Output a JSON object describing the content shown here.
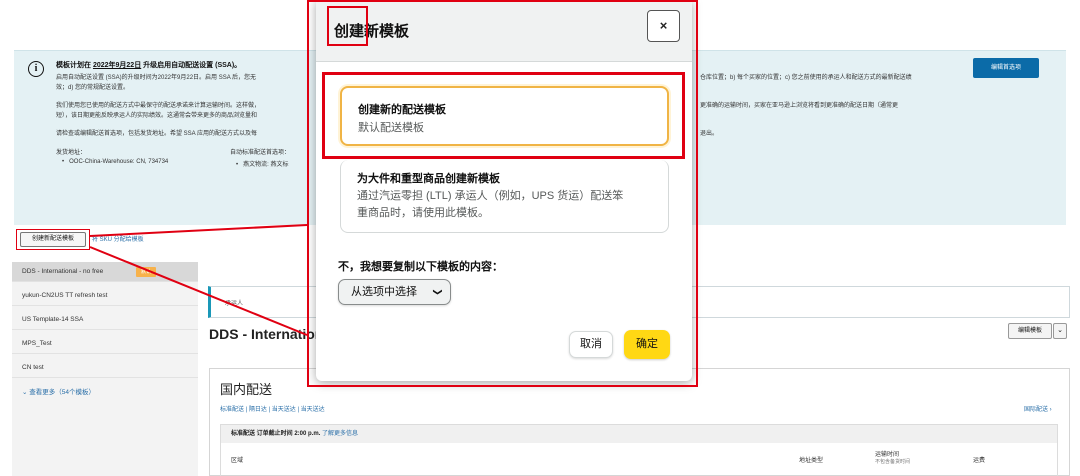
{
  "banner": {
    "title_prefix": "模板计划在",
    "title_date": "2022年9月22日",
    "title_suffix": "升级启用自动配送设置 (SSA)。",
    "line1": "启用自动配送设置 (SSA)的升级时间为2022年9月22日。启用 SSA 后，您无",
    "line2": "效；d) 您的常规配送设置。",
    "line3": "我们使用您已使用的配送方式中最保守的配送承诺来计算运输时间。这样做，",
    "line4": "短），该日期更能反映承运人的实际绩效。这通常会带来更多的商品浏览量和",
    "line5": "请检查或编辑配送首选项，包括发货地址。希望 SSA 应用的配送方式以及每",
    "right1": "仓库位置；b) 每个买家的位置；c) 您之前使用的承运人和配送方式的最新配送绩",
    "right2": "更准确的运输时间，买家在亚马逊上浏览将看到更准确的配送日期（通常更",
    "right3": "退出。",
    "addr_label": "发货地址：",
    "addr_value": "OOC-China-Warehouse: CN, 734734",
    "auto_label": "自动标准配送首选项：",
    "auto_value": "燕文物流: 燕文标",
    "edit_pref_button": "编辑首选项"
  },
  "toolbar": {
    "create_template_button": "创建新配送模板",
    "sku_link": "将 SKU 分配给模板"
  },
  "sidebar": {
    "items": [
      {
        "label": "DDS - International - no free",
        "badge": "默认"
      },
      {
        "label": "yukun-CN2US TT refresh test"
      },
      {
        "label": "US Template-14 SSA"
      },
      {
        "label": "MPS_Test"
      },
      {
        "label": "CN test"
      }
    ],
    "show_more": "⌄ 查看更多（54个模板）"
  },
  "main": {
    "notice": "承运人",
    "template_heading": "DDS - International - no free",
    "edit_template_button": "编辑模板",
    "domestic_title": "国内配送",
    "domestic_links": "标准配送 | 隔日达 | 当天送达 | 当天送达",
    "international_link": "国际配送 ›",
    "standard_prefix": "标准配送 订单截止时间 2:00 p.m.",
    "learn_more": "了解更多信息",
    "col_region": "区域",
    "col_address_type": "地址类型",
    "col_transit": "运输时间",
    "col_transit_sub": "不包含备货时间",
    "col_fee": "运费"
  },
  "modal": {
    "title": "创建新模板",
    "close_glyph": "×",
    "option1_title": "创建新的配送模板",
    "option1_desc": "默认配送模板",
    "option2_title": "为大件和重型商品创建新模板",
    "option2_desc_line1": "通过汽运零担 (LTL) 承运人（例如，UPS 货运）配送笨",
    "option2_desc_line2": "重商品时，请使用此模板。",
    "copy_label": "不，我想要复制以下模板的内容：",
    "select_placeholder": "从选项中选择",
    "cancel_button": "取消",
    "ok_button": "确定"
  },
  "colors": {
    "annotation_red": "#e00012",
    "primary_yellow": "#ffd814",
    "selected_border": "#f0b445",
    "banner_bg": "#e4f1f4",
    "link_blue": "#2a6fa8"
  }
}
